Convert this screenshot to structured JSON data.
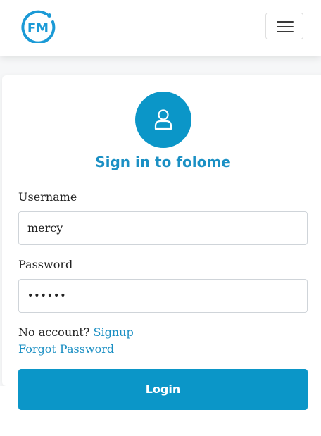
{
  "brand": {
    "logo_text": "FM",
    "logo_icon": "fm-logo-icon",
    "color": "#1b9ad6"
  },
  "navbar": {
    "toggle_icon": "hamburger-icon"
  },
  "login_card": {
    "avatar_icon": "user-icon",
    "title": "Sign in to folome",
    "username_label": "Username",
    "username_value": "mercy",
    "password_label": "Password",
    "password_value": "••••••",
    "no_account_text": "No account?",
    "signup_link": "Signup",
    "forgot_password_link": "Forgot Password",
    "login_button": "Login"
  },
  "colors": {
    "primary": "#0b96c8",
    "link": "#1b8fc3",
    "title": "#1b90c4"
  }
}
